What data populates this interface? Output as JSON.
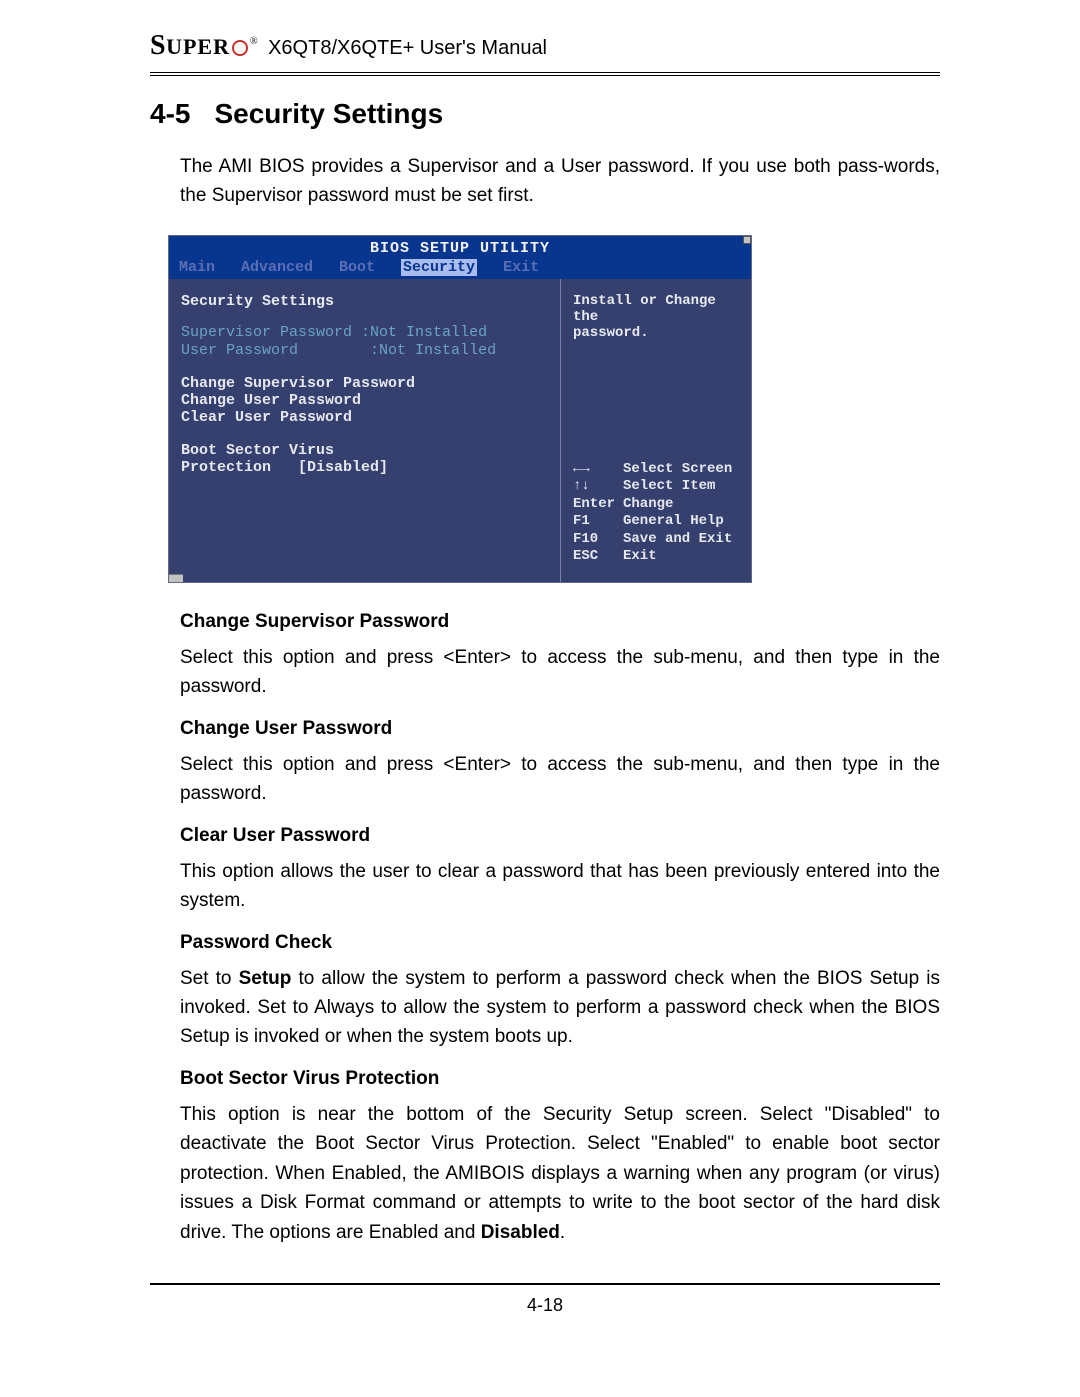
{
  "header": {
    "brand_big": "S",
    "brand_rest": "UPER",
    "manual_title": "X6QT8/X6QTE+ User's Manual"
  },
  "section": {
    "number": "4-5",
    "title": "Security Settings",
    "intro": "The AMI BIOS provides a Supervisor and a User password. If you use both pass-words, the Supervisor password must be set first."
  },
  "bios": {
    "title": "BIOS SETUP UTILITY",
    "tabs": {
      "main": "Main",
      "advanced": "Advanced",
      "boot": "Boot",
      "security": "Security",
      "exit": "Exit"
    },
    "left": {
      "panel_title": "Security Settings",
      "supervisor_label": "Supervisor Password",
      "supervisor_value": ":Not Installed",
      "user_label": "User Password",
      "user_value": ":Not Installed",
      "menu_change_sup": "Change Supervisor Password",
      "menu_change_usr": "Change User Password",
      "menu_clear_usr": "Clear User Password",
      "boot_sector_label": "Boot Sector Virus Protection",
      "boot_sector_value": "[Disabled]"
    },
    "right": {
      "help_text_1": "Install or Change the",
      "help_text_2": "password.",
      "keys": {
        "select_screen": "Select Screen",
        "select_item": "Select Item",
        "enter": "Enter",
        "enter_txt": "Change",
        "f1": "F1",
        "f1_txt": "General Help",
        "f10": "F10",
        "f10_txt": "Save and Exit",
        "esc": "ESC",
        "esc_txt": "Exit",
        "arrows_lr": "←→",
        "arrows_ud": "↑↓"
      }
    }
  },
  "subsections": [
    {
      "title": "Change Supervisor Password",
      "body": "Select this option and press <Enter> to access the sub-menu, and then type in the password."
    },
    {
      "title": "Change User Password",
      "body": "Select this option and press <Enter> to access the sub-menu, and then type in the password."
    },
    {
      "title": "Clear User Password",
      "body": "This option allows the user to clear a password that has been previously entered into the system."
    },
    {
      "title": "Password Check",
      "body_pre": "Set to ",
      "body_bold": "Setup",
      "body_post": " to allow the system to perform a password check when the BIOS Setup is invoked. Set to Always to allow the system to perform a password check when the BIOS Setup is invoked or when the system boots up."
    },
    {
      "title": "Boot Sector Virus Protection",
      "body_pre": "This option is near the bottom of the Security Setup screen. Select \"Disabled\" to deactivate the Boot Sector Virus Protection. Select \"Enabled\" to enable boot sector protection. When Enabled, the AMIBOIS displays a warning when any program (or virus) issues a Disk Format command or attempts to write to the boot sector of the hard disk drive. The options are Enabled and ",
      "body_bold": "Disabled",
      "body_post": "."
    }
  ],
  "page_number": "4-18"
}
